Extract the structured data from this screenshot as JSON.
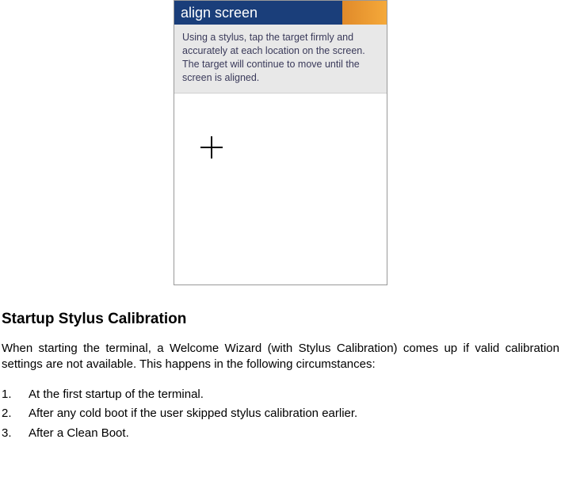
{
  "device": {
    "title": "align screen",
    "instruction": "Using a stylus, tap the target firmly and accurately at each location on the screen. The target will continue to move until the screen is aligned."
  },
  "document": {
    "heading": "Startup Stylus Calibration",
    "paragraph": "When starting the terminal, a Welcome Wizard (with Stylus Calibration) comes up if valid calibration settings are not available. This happens in the following circumstances:",
    "list": [
      "At the first startup of the terminal.",
      "After any cold boot if the user skipped stylus calibration earlier.",
      "After a Clean Boot."
    ]
  }
}
